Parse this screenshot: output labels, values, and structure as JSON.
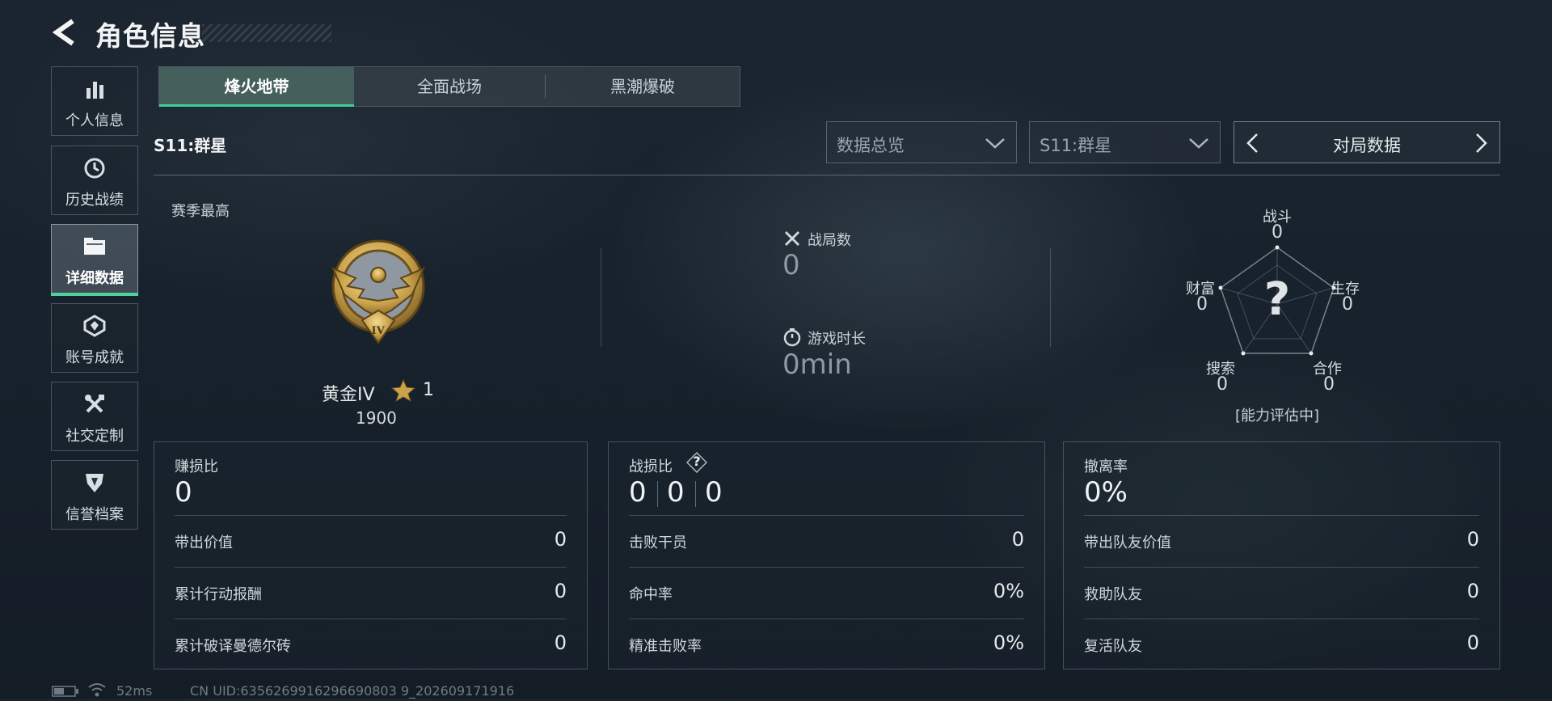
{
  "header": {
    "title": "角色信息"
  },
  "sidebar": {
    "items": [
      {
        "label": "个人信息",
        "icon": "bar-chart-icon"
      },
      {
        "label": "历史战绩",
        "icon": "history-icon"
      },
      {
        "label": "详细数据",
        "icon": "folder-icon",
        "active": true
      },
      {
        "label": "账号成就",
        "icon": "achievement-icon"
      },
      {
        "label": "社交定制",
        "icon": "tools-icon"
      },
      {
        "label": "信誉档案",
        "icon": "shield-icon"
      }
    ]
  },
  "tabs": [
    {
      "label": "烽火地带",
      "active": true
    },
    {
      "label": "全面战场"
    },
    {
      "label": "黑潮爆破"
    }
  ],
  "season": {
    "label": "S11:群星"
  },
  "filters": {
    "scope": "数据总览",
    "season": "S11:群星",
    "pager": "对局数据"
  },
  "rank": {
    "section_label": "赛季最高",
    "name": "黄金IV",
    "stars": "1",
    "score": "1900",
    "badge_numeral": "IV"
  },
  "summary": {
    "matches_label": "战局数",
    "matches_value": "0",
    "playtime_label": "游戏时长",
    "playtime_value": "0min"
  },
  "radar": {
    "center_mark": "?",
    "status": "[能力评估中]",
    "axes": [
      {
        "label": "战斗",
        "value": "0"
      },
      {
        "label": "生存",
        "value": "0"
      },
      {
        "label": "合作",
        "value": "0"
      },
      {
        "label": "搜索",
        "value": "0"
      },
      {
        "label": "财富",
        "value": "0"
      }
    ]
  },
  "panels": {
    "profit": {
      "title": "赚损比",
      "value": "0",
      "rows": [
        {
          "label": "带出价值",
          "value": "0"
        },
        {
          "label": "累计行动报酬",
          "value": "0"
        },
        {
          "label": "累计破译曼德尔砖",
          "value": "0"
        }
      ]
    },
    "combat": {
      "title": "战损比",
      "help": "?",
      "values": [
        "0",
        "0",
        "0"
      ],
      "rows": [
        {
          "label": "击败干员",
          "value": "0"
        },
        {
          "label": "命中率",
          "value": "0%"
        },
        {
          "label": "精准击败率",
          "value": "0%"
        }
      ]
    },
    "extract": {
      "title": "撤离率",
      "value": "0%",
      "rows": [
        {
          "label": "带出队友价值",
          "value": "0"
        },
        {
          "label": "救助队友",
          "value": "0"
        },
        {
          "label": "复活队友",
          "value": "0"
        }
      ]
    }
  },
  "footer": {
    "ping": "52ms",
    "uid": "CN UID:6356269916296690803 9_202609171916"
  },
  "colors": {
    "accent_green": "#3fcf93",
    "gold": "#c9a24a",
    "background": "#17212b"
  }
}
